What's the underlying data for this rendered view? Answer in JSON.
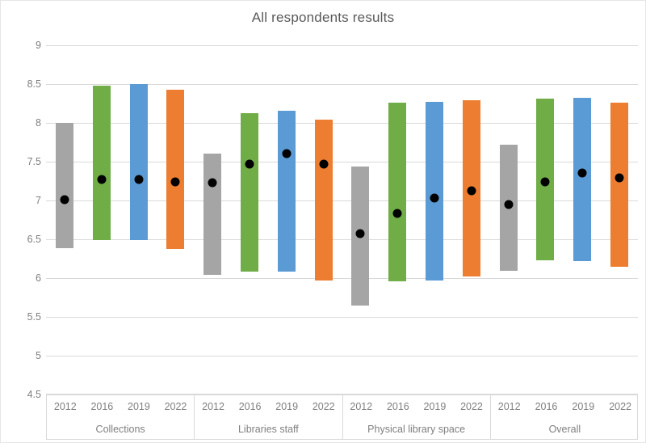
{
  "chart_data": {
    "type": "bar",
    "title": "All respondents results",
    "xlabel": "",
    "ylabel": "",
    "ylim": [
      4.5,
      9
    ],
    "ytick_values": [
      9,
      8.5,
      8,
      7.5,
      7,
      6.5,
      6,
      5.5,
      5,
      4.5
    ],
    "ytick_labels": [
      "9",
      "8.5",
      "8",
      "7.5",
      "7",
      "6.5",
      "6",
      "5.5",
      "5",
      "4.5"
    ],
    "grid": true,
    "legend": "none",
    "groups": [
      "Collections",
      "Libraries staff",
      "Physical library space",
      "Overall"
    ],
    "categories": [
      "2012",
      "2016",
      "2019",
      "2022"
    ],
    "series_note": "Floating (high-low) bars with mean marker dot",
    "colors": {
      "2012": "#A5A5A5",
      "2016": "#70AD47",
      "2019": "#5B9BD5",
      "2022": "#ED7D31",
      "marker": "#000000",
      "gridline": "#D9D9D9",
      "text": "#7F7F7F",
      "title": "#595959",
      "background": "#FFFFFF"
    },
    "bars": [
      {
        "group": "Collections",
        "year": "2012",
        "color": "#A5A5A5",
        "high": 8.0,
        "low": 6.39,
        "mean": 7.01
      },
      {
        "group": "Collections",
        "year": "2016",
        "color": "#70AD47",
        "high": 8.48,
        "low": 6.49,
        "mean": 7.27
      },
      {
        "group": "Collections",
        "year": "2019",
        "color": "#5B9BD5",
        "high": 8.5,
        "low": 6.49,
        "mean": 7.27
      },
      {
        "group": "Collections",
        "year": "2022",
        "color": "#ED7D31",
        "high": 8.43,
        "low": 6.37,
        "mean": 7.24
      },
      {
        "group": "Libraries staff",
        "year": "2012",
        "color": "#A5A5A5",
        "high": 7.6,
        "low": 6.04,
        "mean": 7.23
      },
      {
        "group": "Libraries staff",
        "year": "2016",
        "color": "#70AD47",
        "high": 8.13,
        "low": 6.08,
        "mean": 7.47
      },
      {
        "group": "Libraries staff",
        "year": "2019",
        "color": "#5B9BD5",
        "high": 8.16,
        "low": 6.08,
        "mean": 7.6
      },
      {
        "group": "Libraries staff",
        "year": "2022",
        "color": "#ED7D31",
        "high": 8.04,
        "low": 5.97,
        "mean": 7.47
      },
      {
        "group": "Physical library space",
        "year": "2012",
        "color": "#A5A5A5",
        "high": 7.44,
        "low": 5.65,
        "mean": 6.57
      },
      {
        "group": "Physical library space",
        "year": "2016",
        "color": "#70AD47",
        "high": 8.26,
        "low": 5.96,
        "mean": 6.83
      },
      {
        "group": "Physical library space",
        "year": "2019",
        "color": "#5B9BD5",
        "high": 8.27,
        "low": 5.97,
        "mean": 7.03
      },
      {
        "group": "Physical library space",
        "year": "2022",
        "color": "#ED7D31",
        "high": 8.29,
        "low": 6.02,
        "mean": 7.12
      },
      {
        "group": "Overall",
        "year": "2012",
        "color": "#A5A5A5",
        "high": 7.72,
        "low": 6.09,
        "mean": 6.95
      },
      {
        "group": "Overall",
        "year": "2016",
        "color": "#70AD47",
        "high": 8.31,
        "low": 6.23,
        "mean": 7.24
      },
      {
        "group": "Overall",
        "year": "2019",
        "color": "#5B9BD5",
        "high": 8.32,
        "low": 6.22,
        "mean": 7.35
      },
      {
        "group": "Overall",
        "year": "2022",
        "color": "#ED7D31",
        "high": 8.26,
        "low": 6.15,
        "mean": 7.29
      }
    ]
  }
}
